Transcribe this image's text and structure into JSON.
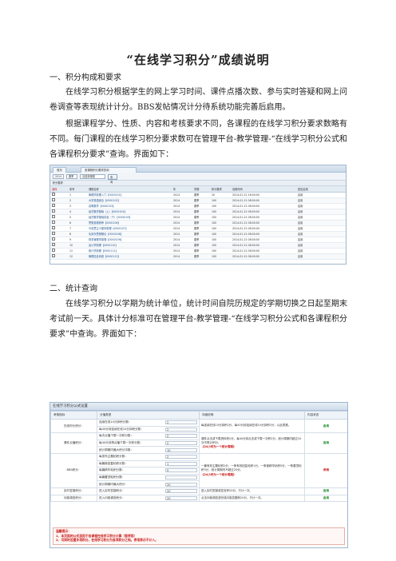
{
  "doc": {
    "title": "“在线学习积分”成绩说明",
    "section1": "一、积分构成和要求",
    "p1": "在线学习积分根据学生的网上学习时间、课件点播次数、参与实时答疑和网上问卷调查等表现统计计分。BBS发帖情况计分待系统功能完善后启用。",
    "p2": "根据课程学分、性质、内容和考核要求不同，各课程的在线学习积分要求数略有不同。每门课程的在线学习积分要求数可在管理平台-教学管理-“在线学习积分公式和各课程积分要求”查询。界面如下：",
    "section2": "二、统计查询",
    "p3": "在线学习积分以学期为统计单位，统计时间自院历规定的学期切换之日起至期末考试前一天。具体计分标准可在管理平台-教学管理-“在线学习积分公式和各课程积分要求”中查询。界面如下："
  },
  "shot1": {
    "tabs": [
      "首页",
      "各课程积分要求查询"
    ],
    "filter": {
      "year": "2014",
      "term": "春季",
      "course": "请选择课程",
      "button": "查询"
    },
    "strip": "积分要求",
    "columns": [
      "选择",
      "序号",
      "课程名称",
      "年",
      "学期",
      "积分要求",
      "设置时间",
      "是否启用"
    ],
    "rows": [
      [
        "1",
        "管理学原理入门【0000101】",
        "2014",
        "春季",
        "20",
        "2014-01-21 16:00:00",
        "启用"
      ],
      [
        "2",
        "大学英语综合【0000102】",
        "2014",
        "春季",
        "100",
        "2014-01-21 08:00:00",
        "启用"
      ],
      [
        "3",
        "高等数学【0000103】",
        "2014",
        "春季",
        "100",
        "2014-01-21 08:00:00",
        "启用"
      ],
      [
        "4",
        "经济数学基础（上）【0000104】",
        "2014",
        "春季",
        "100",
        "2014-01-21 08:00:00",
        "启用"
      ],
      [
        "5",
        "经济数学基础实验（下）【0000105】",
        "2014",
        "春季",
        "100",
        "2014-01-21 08:00:00",
        "启用"
      ],
      [
        "6",
        "思想道德修养【0000106】",
        "2014",
        "春季",
        "100",
        "2014-01-21 08:00:00",
        "启用"
      ],
      [
        "7",
        "马克思主义基本原理【0000107】",
        "2014",
        "春季",
        "100",
        "2014-01-21 08:00:00",
        "启用"
      ],
      [
        "8",
        "毛泽东思想概论【0000108】",
        "2014",
        "春季",
        "100",
        "2014-01-21 08:00:00",
        "启用"
      ],
      [
        "9",
        "财务管理学原理【0000109】",
        "2014",
        "春季",
        "100",
        "2014-01-21 08:00:00",
        "启用"
      ],
      [
        "10",
        "会计学原理【0000110】",
        "2014",
        "春季",
        "100",
        "2014-01-21 08:00:00",
        "启用"
      ],
      [
        "11",
        "统计学原理【0000111】",
        "2014",
        "春季",
        "100",
        "2014-01-21 08:00:00",
        "启用"
      ],
      [
        "12",
        "管理信息系统【0000112】",
        "2014",
        "春季",
        "100",
        "2014-01-21 08:00:00",
        "启用"
      ]
    ]
  },
  "shot2": {
    "title": "在线学习积分公式设置",
    "columns": [
      "考核指标",
      "分值类型",
      "详细说明",
      "内容状态"
    ],
    "rows": [
      {
        "cat": "在线时长积分：",
        "items": [
          [
            "连续在线10分钟积分数：",
            "2"
          ],
          [
            "每40分钟连续在线10分钟积分数：",
            "2"
          ]
        ],
        "desc": "每连续在线10分钟积2分，每40分钟连续在线10分钟积2分，以此类推。",
        "status": "启用"
      },
      {
        "cat": "课件点播积分：",
        "items": [
          [
            "每次点播下载一次积分数：",
            "2"
          ],
          [
            "每40分钟再点播下载一次积分数：",
            "2"
          ],
          [
            "统计周期内最大积分次数：",
            "10"
          ]
        ],
        "desc": "课件点击或下载资料积2分，每40分钟点击或下载一次积2分。统计周期内超过10次不再计积分。",
        "link": "《24小时为一个统计周期》",
        "status": "启用"
      },
      {
        "cat": "BBS积分：",
        "items": [
          [
            "每发布主题帖积分数：",
            "2"
          ],
          [
            "每篇被回复帖积分数：",
            "1"
          ],
          [
            "每篇精华帖积分数：",
            "5"
          ],
          [
            "每篇置顶帖积分数：",
            ""
          ],
          [
            "统计周期内最大积分：",
            "20"
          ]
        ],
        "desc": "一篇有效主题帖积2分，一条有效回复帖积1分，一条被精华帖积5分，一条置顶帖积3分，统计周期内不超过20分。",
        "link": "《24小时为一个统计周期》",
        "status": "停用"
      },
      {
        "cat": "实时答疑积分：",
        "items": [
          [
            "进入实时答疑积分：",
            "20"
          ]
        ],
        "desc": "进入实时答疑或发言积20分，只计一次。",
        "status": "启用"
      },
      {
        "cat": "问卷调查积分：",
        "items": [
          [
            "进入问卷调查积分：",
            "20"
          ]
        ],
        "desc": "点击问卷调查或完成问卷答题积20分，只计一次。",
        "status": "启用"
      }
    ],
    "notes_title": "温馨提示：",
    "note1": "1、本页面的公式适用于各课程在线学习积分计算（暂停用）",
    "note2": "2、可同时设置多项积分，在线学习积分为各项积分之和。停用表示不计入。"
  }
}
